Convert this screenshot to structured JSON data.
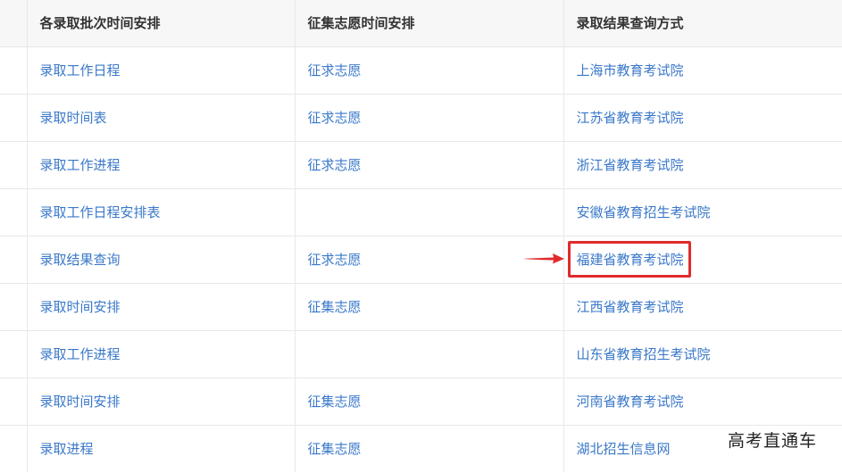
{
  "table": {
    "headers": [
      "",
      "各录取批次时间安排",
      "征集志愿时间安排",
      "录取结果查询方式"
    ],
    "rows": [
      {
        "schedule": "录取工作日程",
        "solicit": "征求志愿",
        "query": "上海市教育考试院"
      },
      {
        "schedule": "录取时间表",
        "solicit": "征求志愿",
        "query": "江苏省教育考试院"
      },
      {
        "schedule": "录取工作进程",
        "solicit": "征求志愿",
        "query": "浙江省教育考试院"
      },
      {
        "schedule": "录取工作日程安排表",
        "solicit": "",
        "query": "安徽省教育招生考试院"
      },
      {
        "schedule": "录取结果查询",
        "solicit": "征求志愿",
        "query": "福建省教育考试院"
      },
      {
        "schedule": "录取时间安排",
        "solicit": "征集志愿",
        "query": "江西省教育考试院"
      },
      {
        "schedule": "录取工作进程",
        "solicit": "",
        "query": "山东省教育招生考试院"
      },
      {
        "schedule": "录取时间安排",
        "solicit": "征集志愿",
        "query": "河南省教育考试院"
      },
      {
        "schedule": "录取进程",
        "solicit": "征集志愿",
        "query": "湖北招生信息网"
      }
    ]
  },
  "highlighted_row": 4,
  "colors": {
    "link": "#3a78c9",
    "header_bg": "#f7f7f7",
    "highlight": "#e02b2b"
  },
  "watermark": "高考直通车"
}
